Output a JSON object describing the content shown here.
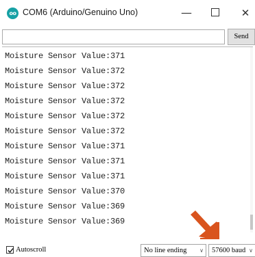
{
  "window": {
    "title": "COM6 (Arduino/Genuino Uno)",
    "app_icon_text": "oo",
    "minimize_glyph": "—",
    "close_glyph": "✕"
  },
  "send": {
    "input_value": "",
    "button_label": "Send"
  },
  "output": {
    "lines": [
      "Moisture Sensor Value:371",
      "Moisture Sensor Value:372",
      "Moisture Sensor Value:372",
      "Moisture Sensor Value:372",
      "Moisture Sensor Value:372",
      "Moisture Sensor Value:372",
      "Moisture Sensor Value:371",
      "Moisture Sensor Value:371",
      "Moisture Sensor Value:371",
      "Moisture Sensor Value:370",
      "Moisture Sensor Value:369",
      "Moisture Sensor Value:369"
    ]
  },
  "footer": {
    "autoscroll_label": "Autoscroll",
    "autoscroll_checked": true,
    "line_ending_value": "No line ending",
    "baud_value": "57600 baud",
    "chevron_glyph": "∨"
  },
  "colors": {
    "arrow": "#d9541e",
    "app_icon": "#17a1a5"
  },
  "icons": {
    "app": "arduino-logo-icon",
    "minimize": "minimize-icon",
    "maximize": "maximize-icon",
    "close": "close-icon",
    "annotation": "arrow-pointer-icon"
  }
}
